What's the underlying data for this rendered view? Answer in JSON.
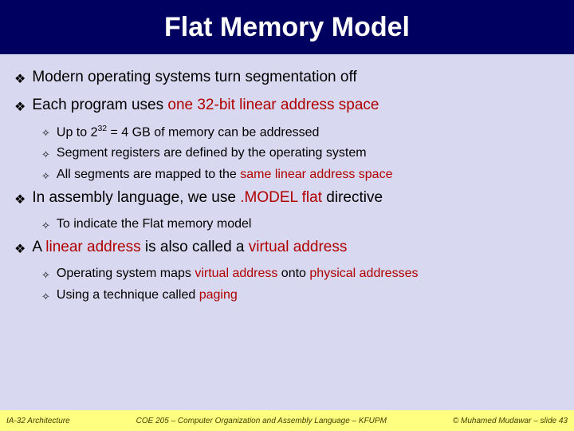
{
  "title": "Flat Memory Model",
  "bullets": {
    "p1": "Modern operating systems turn segmentation off",
    "p2_a": "Each program uses ",
    "p2_hl": "one 32-bit linear address space",
    "p2_s1_a": "Up to 2",
    "p2_s1_sup": "32",
    "p2_s1_b": " = 4 GB of memory can be addressed",
    "p2_s2": "Segment registers are defined by the operating system",
    "p2_s3_a": "All segments are mapped to the ",
    "p2_s3_hl": "same linear address space",
    "p3_a": "In assembly language, we use ",
    "p3_hl": ".MODEL flat",
    "p3_b": " directive",
    "p3_s1": "To indicate the Flat memory model",
    "p4_a": "A ",
    "p4_hl": "linear address",
    "p4_b": " is also called a ",
    "p4_hl2": "virtual address",
    "p4_s1_a": "Operating system maps ",
    "p4_s1_hl1": "virtual address",
    "p4_s1_b": " onto ",
    "p4_s1_hl2": "physical addresses",
    "p4_s2_a": "Using a technique called ",
    "p4_s2_hl": "paging"
  },
  "footer": {
    "left": "IA-32 Architecture",
    "center": "COE 205 – Computer Organization and Assembly Language – KFUPM",
    "right": "© Muhamed Mudawar – slide 43"
  }
}
